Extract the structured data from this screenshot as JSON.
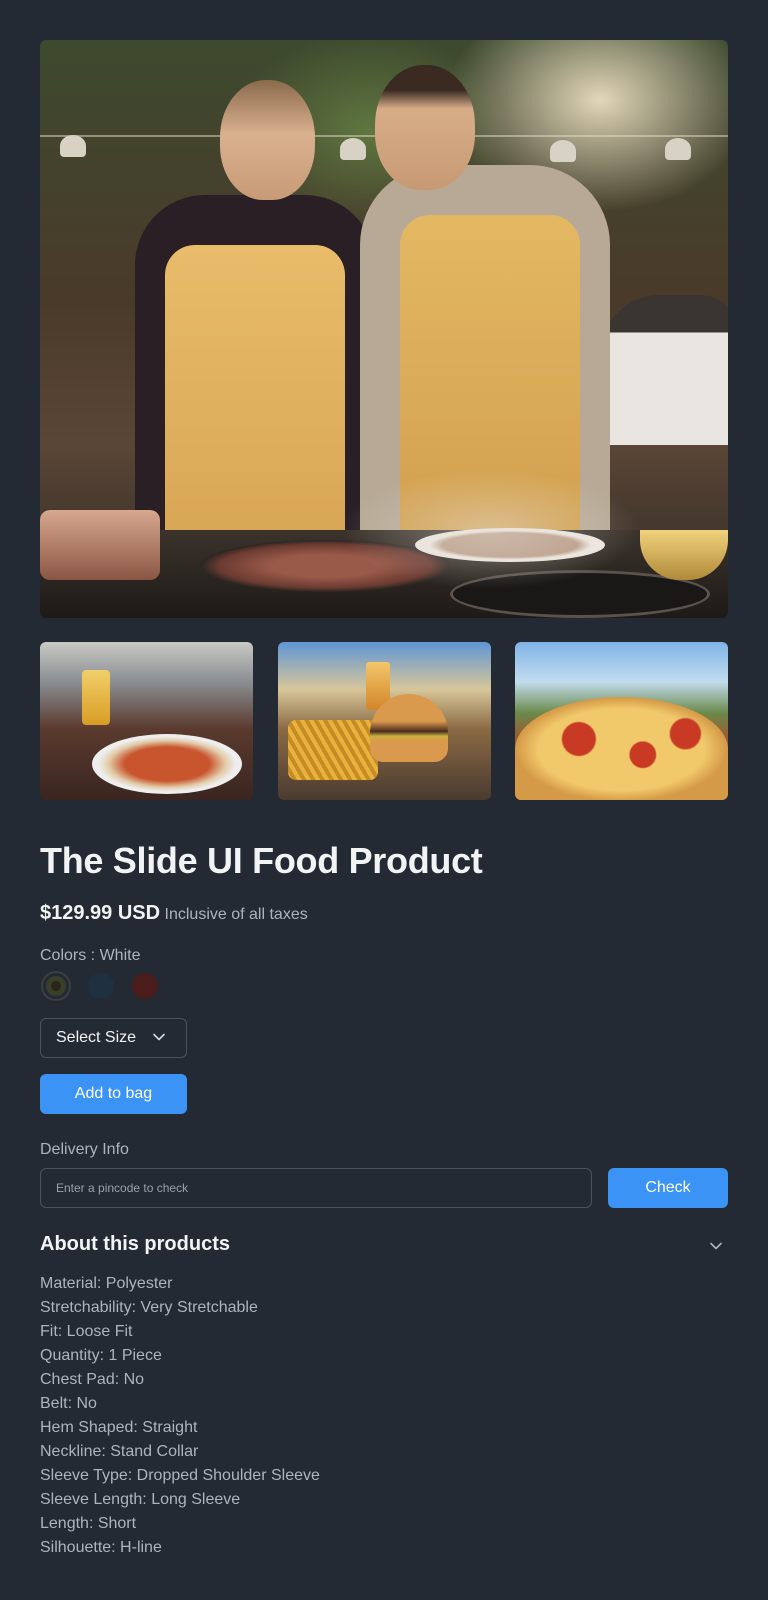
{
  "product": {
    "title": "The Slide UI Food Product",
    "price": "$129.99 USD",
    "tax_note": "Inclusive of all taxes"
  },
  "gallery": {
    "main_image": "chefs-grilling-photo",
    "thumbnails": [
      "pasta-plate-photo",
      "burger-fries-photo",
      "pizza-photo"
    ]
  },
  "colors": {
    "label": "Colors : White",
    "swatches": [
      "#3a3f2a",
      "#1f3040",
      "#4a1c1c"
    ],
    "selected_index": 0
  },
  "size": {
    "select_label": "Select Size",
    "icon": "chevron-down-icon"
  },
  "actions": {
    "add_to_bag": "Add to bag"
  },
  "delivery": {
    "label": "Delivery Info",
    "placeholder": "Enter a pincode to check",
    "value": "",
    "check_label": "Check"
  },
  "about": {
    "title": "About this products",
    "icon": "chevron-down-icon",
    "specs": [
      "Material: Polyester",
      "Stretchability: Very Stretchable",
      "Fit: Loose Fit",
      "Quantity: 1 Piece",
      "Chest Pad: No",
      "Belt: No",
      "Hem Shaped: Straight",
      "Neckline: Stand Collar",
      "Sleeve Type: Dropped Shoulder Sleeve",
      "Sleeve Length: Long Sleeve",
      "Length: Short",
      "Silhouette: H-line"
    ]
  },
  "theme": {
    "background": "#242a33",
    "accent": "#3b94f5"
  }
}
